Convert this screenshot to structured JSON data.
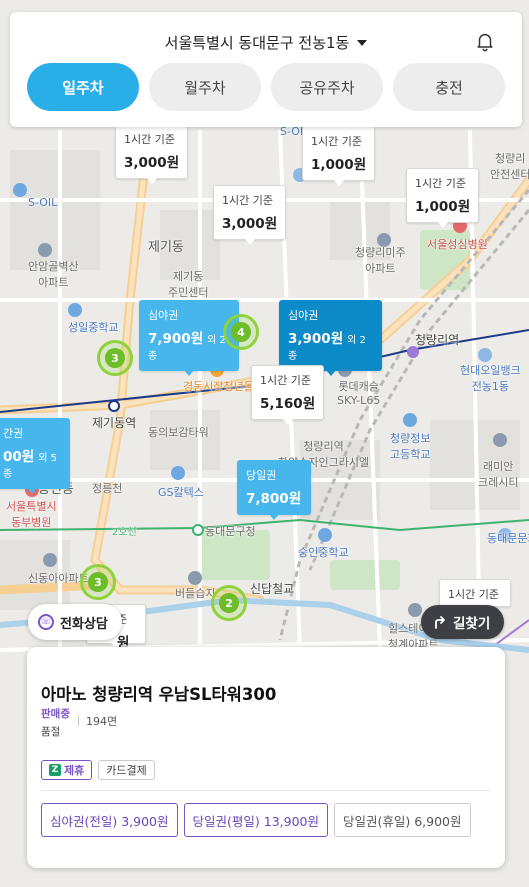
{
  "header": {
    "location": "서울특별시 동대문구 전농1동",
    "tabs": [
      {
        "label": "일주차",
        "active": true
      },
      {
        "label": "월주차",
        "active": false
      },
      {
        "label": "공유주차",
        "active": false
      },
      {
        "label": "충전",
        "active": false
      }
    ]
  },
  "map": {
    "labels": {
      "soil1": "S-OIL",
      "soil2": "S-OIL",
      "anam": "안암골벽산\n아파트",
      "jegi": "제기동",
      "jegi_center": "제기동\n주민센터",
      "seongil": "성일중학교",
      "cheongri_mijoo": "청량리미주\n아파트",
      "seoul_sungsim": "서울성심병원",
      "cheongri_station": "청량리역",
      "hyundai": "현대오일뱅크\n전농1동",
      "gyeongdong": "경동시장청년몰",
      "lotte": "롯데캐슬\nSKY-L65",
      "jegidong_station": "제기동역",
      "dongbo": "동의보감타워",
      "cheongri_youth": "청량리역\n한양수자인그라시엘",
      "cheongryang_school": "청량정보\n고등학교",
      "raemian": "래미안\n크레시티",
      "yongsin": "용신동",
      "seoul_dongbu": "서울특별시\n동부병원",
      "jeongneung": "정릉천",
      "gs": "GS칼텍스",
      "line2": "2호선",
      "dongdaemun_office": "동대문구청",
      "dongdaemun_cultural": "동대문문화",
      "sinseol_apt": "신동아아파트",
      "sungin": "숭인중학교",
      "sindap": "신답철교",
      "budeul": "버들습지",
      "hills": "힐스테이트\n청계아파트",
      "jeonggye": "청량리\n안전센터"
    },
    "pins": [
      {
        "id": "p1",
        "label": "1시간 기준",
        "price": "3,000원"
      },
      {
        "id": "p2",
        "label": "1시간 기준",
        "price": "1,000원"
      },
      {
        "id": "p3",
        "label": "1시간 기준",
        "price": "1,000원"
      },
      {
        "id": "p4",
        "label": "1시간 기준",
        "price": "3,000원"
      },
      {
        "id": "p5",
        "label": "심야권",
        "price": "7,900원",
        "extra": "외 2종"
      },
      {
        "id": "p6",
        "label": "심야권",
        "price": "3,900원",
        "extra": "외 2종"
      },
      {
        "id": "p7",
        "label": "1시간 기준",
        "price": "5,160원"
      },
      {
        "id": "p8",
        "label": "간권",
        "price": "00원",
        "extra": "외 5종"
      },
      {
        "id": "p9",
        "label": "당일권",
        "price": "7,800원"
      },
      {
        "id": "p10",
        "label": "1시간 기준",
        "price": ""
      },
      {
        "id": "p11",
        "label": "준",
        "price": "원"
      }
    ],
    "clusters": [
      {
        "id": "c1",
        "count": "3"
      },
      {
        "id": "c2",
        "count": "4"
      },
      {
        "id": "c3",
        "count": "3"
      },
      {
        "id": "c4",
        "count": "2"
      }
    ]
  },
  "buttons": {
    "call": "전화상담",
    "route": "길찾기"
  },
  "card": {
    "title": "아마노 청량리역 우남SL타워300",
    "status": "판매중",
    "soldout": "품절",
    "count": "194면",
    "chips": [
      "제휴",
      "카드결제"
    ],
    "tickets": [
      {
        "label": "심야권(전일) 3,900원",
        "highlight": true
      },
      {
        "label": "당일권(평일) 13,900원",
        "highlight": true
      },
      {
        "label": "당일권(휴일) 6,900원",
        "highlight": false
      }
    ]
  }
}
